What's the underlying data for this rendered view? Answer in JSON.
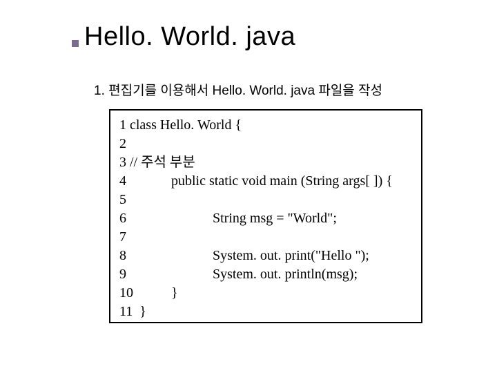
{
  "heading": "Hello. World. java",
  "subtitle": "1. 편집기를 이용해서 Hello. World. java 파일을 작성",
  "code": {
    "lines": [
      {
        "n": " 1",
        "t": " class Hello. World {"
      },
      {
        "n": " 2",
        "t": ""
      },
      {
        "n": " 3",
        "t": " // 주석 부분"
      },
      {
        "n": " 4",
        "t": "             public static void main (String args[ ]) {"
      },
      {
        "n": " 5",
        "t": ""
      },
      {
        "n": " 6",
        "t": "                         String msg = \"World\";"
      },
      {
        "n": " 7",
        "t": ""
      },
      {
        "n": " 8",
        "t": "                         System. out. print(\"Hello \");"
      },
      {
        "n": " 9",
        "t": "                         System. out. println(msg);"
      },
      {
        "n": " 10",
        "t": "           }"
      },
      {
        "n": " 11",
        "t": "  }"
      }
    ]
  }
}
